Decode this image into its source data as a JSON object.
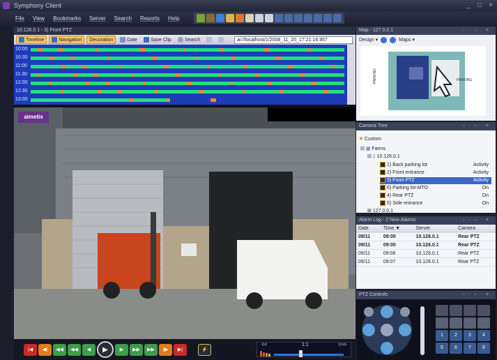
{
  "window": {
    "title": "Symphony Client",
    "controls": [
      "_",
      "□",
      "×"
    ]
  },
  "menu": [
    "File",
    "View",
    "Bookmarks",
    "Server",
    "Search",
    "Reports",
    "Help"
  ],
  "left": {
    "pane_title": "10.126.0.1 - 3) Front PTZ",
    "toolbar": {
      "timeline": "Timeline",
      "navigation": "Navigation",
      "decoration": "Decoration",
      "date": "Date",
      "save_clip": "Save Clip",
      "search": "Search",
      "url": "ai://localhost/1/2008_11_20_17:21:16.957"
    },
    "timeline_rows": [
      "10:00",
      "10:30",
      "11:00",
      "11:30",
      "12:00",
      "12:30",
      "13:00"
    ],
    "video_logo": "aimetis",
    "speed_labels": {
      "left": "<<",
      "center": "1:1",
      "right": ">>>"
    }
  },
  "map": {
    "pane_title": "Map - 127.0.0.1",
    "design": "Design",
    "maps": "Maps",
    "label_left": "PARKING",
    "label_right": "PARKING"
  },
  "camera_tree": {
    "pane_title": "Camera Tree",
    "custom": "Custom",
    "farms": "Farms",
    "server": "10.126.0.1",
    "cameras": [
      {
        "name": "1) Back parking lot",
        "status": "Activity"
      },
      {
        "name": "2) Front entrance",
        "status": "Activity"
      },
      {
        "name": "3) Front PTZ",
        "status": "Activity"
      },
      {
        "name": "6) Parking lot-MTO",
        "status": "On"
      },
      {
        "name": "4) Rear PTZ",
        "status": "On"
      },
      {
        "name": "5) Side entrance",
        "status": "On"
      }
    ],
    "next": "127.0.0.1"
  },
  "alarm_log": {
    "pane_title": "Alarm Log - 2 New Alarms",
    "headers": [
      "Date",
      "Time",
      "Server",
      "Camera"
    ],
    "rows": [
      {
        "date": "09/11",
        "time": "09:00",
        "server": "10.126.0.1",
        "camera": "Rear PTZ",
        "bold": true
      },
      {
        "date": "09/11",
        "time": "09:00",
        "server": "10.126.0.1",
        "camera": "Rear PTZ",
        "bold": true
      },
      {
        "date": "09/11",
        "time": "09:08",
        "server": "10.126.0.1",
        "camera": "Rear PTZ",
        "bold": false
      },
      {
        "date": "09/11",
        "time": "09:07",
        "server": "10.126.0.1",
        "camera": "Rear PTZ",
        "bold": false
      }
    ]
  },
  "ptz": {
    "pane_title": "PTZ Controls",
    "presets": [
      "1",
      "2",
      "3",
      "4",
      "5",
      "6",
      "7",
      "8"
    ]
  }
}
